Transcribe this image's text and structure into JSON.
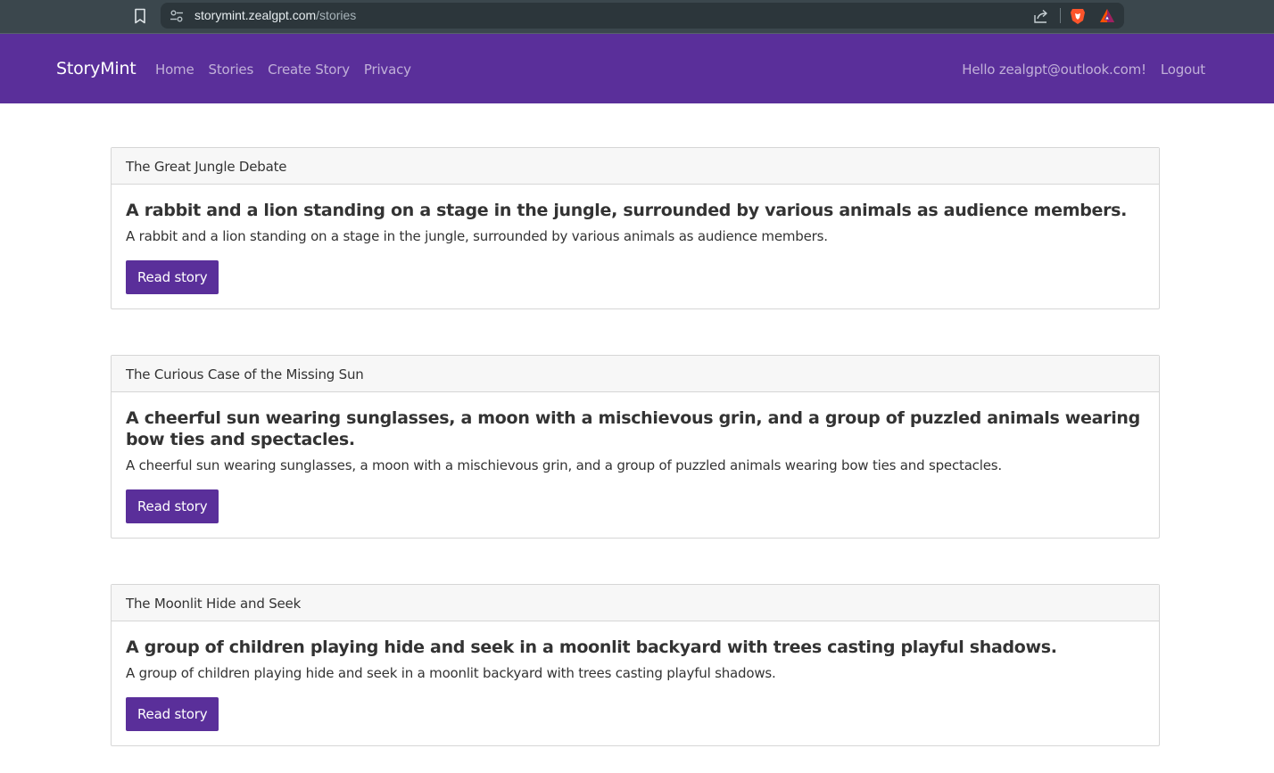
{
  "browser": {
    "url_host": "storymint.zealgpt.com",
    "url_path": "/stories",
    "icons": [
      "bookmark-icon",
      "site-settings-icon",
      "share-icon",
      "brave-shields-icon",
      "brave-rewards-icon"
    ]
  },
  "navbar": {
    "brand": "StoryMint",
    "links": [
      "Home",
      "Stories",
      "Create Story",
      "Privacy"
    ],
    "greeting": "Hello zealgpt@outlook.com!",
    "logout": "Logout",
    "color": "#5a2f9a"
  },
  "stories": [
    {
      "header": "The Great Jungle Debate",
      "title": "A rabbit and a lion standing on a stage in the jungle, surrounded by various animals as audience members.",
      "text": "A rabbit and a lion standing on a stage in the jungle, surrounded by various animals as audience members.",
      "button": "Read story"
    },
    {
      "header": "The Curious Case of the Missing Sun",
      "title": "A cheerful sun wearing sunglasses, a moon with a mischievous grin, and a group of puzzled animals wearing bow ties and spectacles.",
      "text": "A cheerful sun wearing sunglasses, a moon with a mischievous grin, and a group of puzzled animals wearing bow ties and spectacles.",
      "button": "Read story"
    },
    {
      "header": "The Moonlit Hide and Seek",
      "title": "A group of children playing hide and seek in a moonlit backyard with trees casting playful shadows.",
      "text": "A group of children playing hide and seek in a moonlit backyard with trees casting playful shadows.",
      "button": "Read story"
    }
  ]
}
